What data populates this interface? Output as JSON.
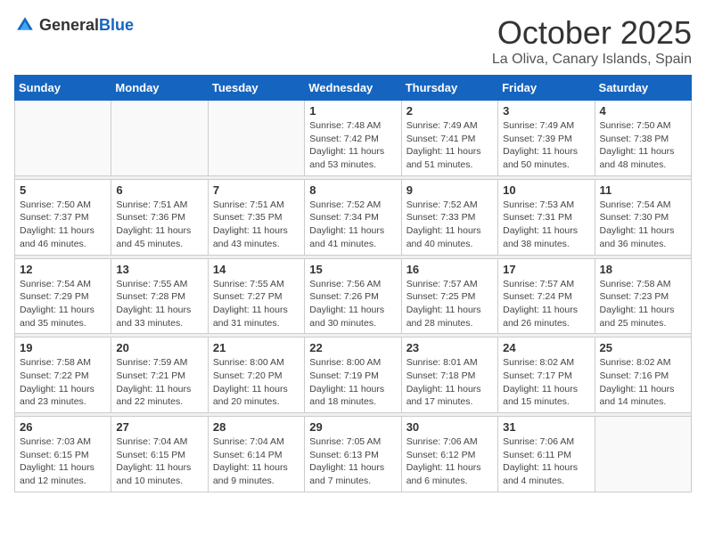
{
  "header": {
    "logo_general": "General",
    "logo_blue": "Blue",
    "month": "October 2025",
    "location": "La Oliva, Canary Islands, Spain"
  },
  "days_of_week": [
    "Sunday",
    "Monday",
    "Tuesday",
    "Wednesday",
    "Thursday",
    "Friday",
    "Saturday"
  ],
  "weeks": [
    [
      {
        "day": "",
        "sunrise": "",
        "sunset": "",
        "daylight": ""
      },
      {
        "day": "",
        "sunrise": "",
        "sunset": "",
        "daylight": ""
      },
      {
        "day": "",
        "sunrise": "",
        "sunset": "",
        "daylight": ""
      },
      {
        "day": "1",
        "sunrise": "Sunrise: 7:48 AM",
        "sunset": "Sunset: 7:42 PM",
        "daylight": "Daylight: 11 hours and 53 minutes."
      },
      {
        "day": "2",
        "sunrise": "Sunrise: 7:49 AM",
        "sunset": "Sunset: 7:41 PM",
        "daylight": "Daylight: 11 hours and 51 minutes."
      },
      {
        "day": "3",
        "sunrise": "Sunrise: 7:49 AM",
        "sunset": "Sunset: 7:39 PM",
        "daylight": "Daylight: 11 hours and 50 minutes."
      },
      {
        "day": "4",
        "sunrise": "Sunrise: 7:50 AM",
        "sunset": "Sunset: 7:38 PM",
        "daylight": "Daylight: 11 hours and 48 minutes."
      }
    ],
    [
      {
        "day": "5",
        "sunrise": "Sunrise: 7:50 AM",
        "sunset": "Sunset: 7:37 PM",
        "daylight": "Daylight: 11 hours and 46 minutes."
      },
      {
        "day": "6",
        "sunrise": "Sunrise: 7:51 AM",
        "sunset": "Sunset: 7:36 PM",
        "daylight": "Daylight: 11 hours and 45 minutes."
      },
      {
        "day": "7",
        "sunrise": "Sunrise: 7:51 AM",
        "sunset": "Sunset: 7:35 PM",
        "daylight": "Daylight: 11 hours and 43 minutes."
      },
      {
        "day": "8",
        "sunrise": "Sunrise: 7:52 AM",
        "sunset": "Sunset: 7:34 PM",
        "daylight": "Daylight: 11 hours and 41 minutes."
      },
      {
        "day": "9",
        "sunrise": "Sunrise: 7:52 AM",
        "sunset": "Sunset: 7:33 PM",
        "daylight": "Daylight: 11 hours and 40 minutes."
      },
      {
        "day": "10",
        "sunrise": "Sunrise: 7:53 AM",
        "sunset": "Sunset: 7:31 PM",
        "daylight": "Daylight: 11 hours and 38 minutes."
      },
      {
        "day": "11",
        "sunrise": "Sunrise: 7:54 AM",
        "sunset": "Sunset: 7:30 PM",
        "daylight": "Daylight: 11 hours and 36 minutes."
      }
    ],
    [
      {
        "day": "12",
        "sunrise": "Sunrise: 7:54 AM",
        "sunset": "Sunset: 7:29 PM",
        "daylight": "Daylight: 11 hours and 35 minutes."
      },
      {
        "day": "13",
        "sunrise": "Sunrise: 7:55 AM",
        "sunset": "Sunset: 7:28 PM",
        "daylight": "Daylight: 11 hours and 33 minutes."
      },
      {
        "day": "14",
        "sunrise": "Sunrise: 7:55 AM",
        "sunset": "Sunset: 7:27 PM",
        "daylight": "Daylight: 11 hours and 31 minutes."
      },
      {
        "day": "15",
        "sunrise": "Sunrise: 7:56 AM",
        "sunset": "Sunset: 7:26 PM",
        "daylight": "Daylight: 11 hours and 30 minutes."
      },
      {
        "day": "16",
        "sunrise": "Sunrise: 7:57 AM",
        "sunset": "Sunset: 7:25 PM",
        "daylight": "Daylight: 11 hours and 28 minutes."
      },
      {
        "day": "17",
        "sunrise": "Sunrise: 7:57 AM",
        "sunset": "Sunset: 7:24 PM",
        "daylight": "Daylight: 11 hours and 26 minutes."
      },
      {
        "day": "18",
        "sunrise": "Sunrise: 7:58 AM",
        "sunset": "Sunset: 7:23 PM",
        "daylight": "Daylight: 11 hours and 25 minutes."
      }
    ],
    [
      {
        "day": "19",
        "sunrise": "Sunrise: 7:58 AM",
        "sunset": "Sunset: 7:22 PM",
        "daylight": "Daylight: 11 hours and 23 minutes."
      },
      {
        "day": "20",
        "sunrise": "Sunrise: 7:59 AM",
        "sunset": "Sunset: 7:21 PM",
        "daylight": "Daylight: 11 hours and 22 minutes."
      },
      {
        "day": "21",
        "sunrise": "Sunrise: 8:00 AM",
        "sunset": "Sunset: 7:20 PM",
        "daylight": "Daylight: 11 hours and 20 minutes."
      },
      {
        "day": "22",
        "sunrise": "Sunrise: 8:00 AM",
        "sunset": "Sunset: 7:19 PM",
        "daylight": "Daylight: 11 hours and 18 minutes."
      },
      {
        "day": "23",
        "sunrise": "Sunrise: 8:01 AM",
        "sunset": "Sunset: 7:18 PM",
        "daylight": "Daylight: 11 hours and 17 minutes."
      },
      {
        "day": "24",
        "sunrise": "Sunrise: 8:02 AM",
        "sunset": "Sunset: 7:17 PM",
        "daylight": "Daylight: 11 hours and 15 minutes."
      },
      {
        "day": "25",
        "sunrise": "Sunrise: 8:02 AM",
        "sunset": "Sunset: 7:16 PM",
        "daylight": "Daylight: 11 hours and 14 minutes."
      }
    ],
    [
      {
        "day": "26",
        "sunrise": "Sunrise: 7:03 AM",
        "sunset": "Sunset: 6:15 PM",
        "daylight": "Daylight: 11 hours and 12 minutes."
      },
      {
        "day": "27",
        "sunrise": "Sunrise: 7:04 AM",
        "sunset": "Sunset: 6:15 PM",
        "daylight": "Daylight: 11 hours and 10 minutes."
      },
      {
        "day": "28",
        "sunrise": "Sunrise: 7:04 AM",
        "sunset": "Sunset: 6:14 PM",
        "daylight": "Daylight: 11 hours and 9 minutes."
      },
      {
        "day": "29",
        "sunrise": "Sunrise: 7:05 AM",
        "sunset": "Sunset: 6:13 PM",
        "daylight": "Daylight: 11 hours and 7 minutes."
      },
      {
        "day": "30",
        "sunrise": "Sunrise: 7:06 AM",
        "sunset": "Sunset: 6:12 PM",
        "daylight": "Daylight: 11 hours and 6 minutes."
      },
      {
        "day": "31",
        "sunrise": "Sunrise: 7:06 AM",
        "sunset": "Sunset: 6:11 PM",
        "daylight": "Daylight: 11 hours and 4 minutes."
      },
      {
        "day": "",
        "sunrise": "",
        "sunset": "",
        "daylight": ""
      }
    ]
  ]
}
